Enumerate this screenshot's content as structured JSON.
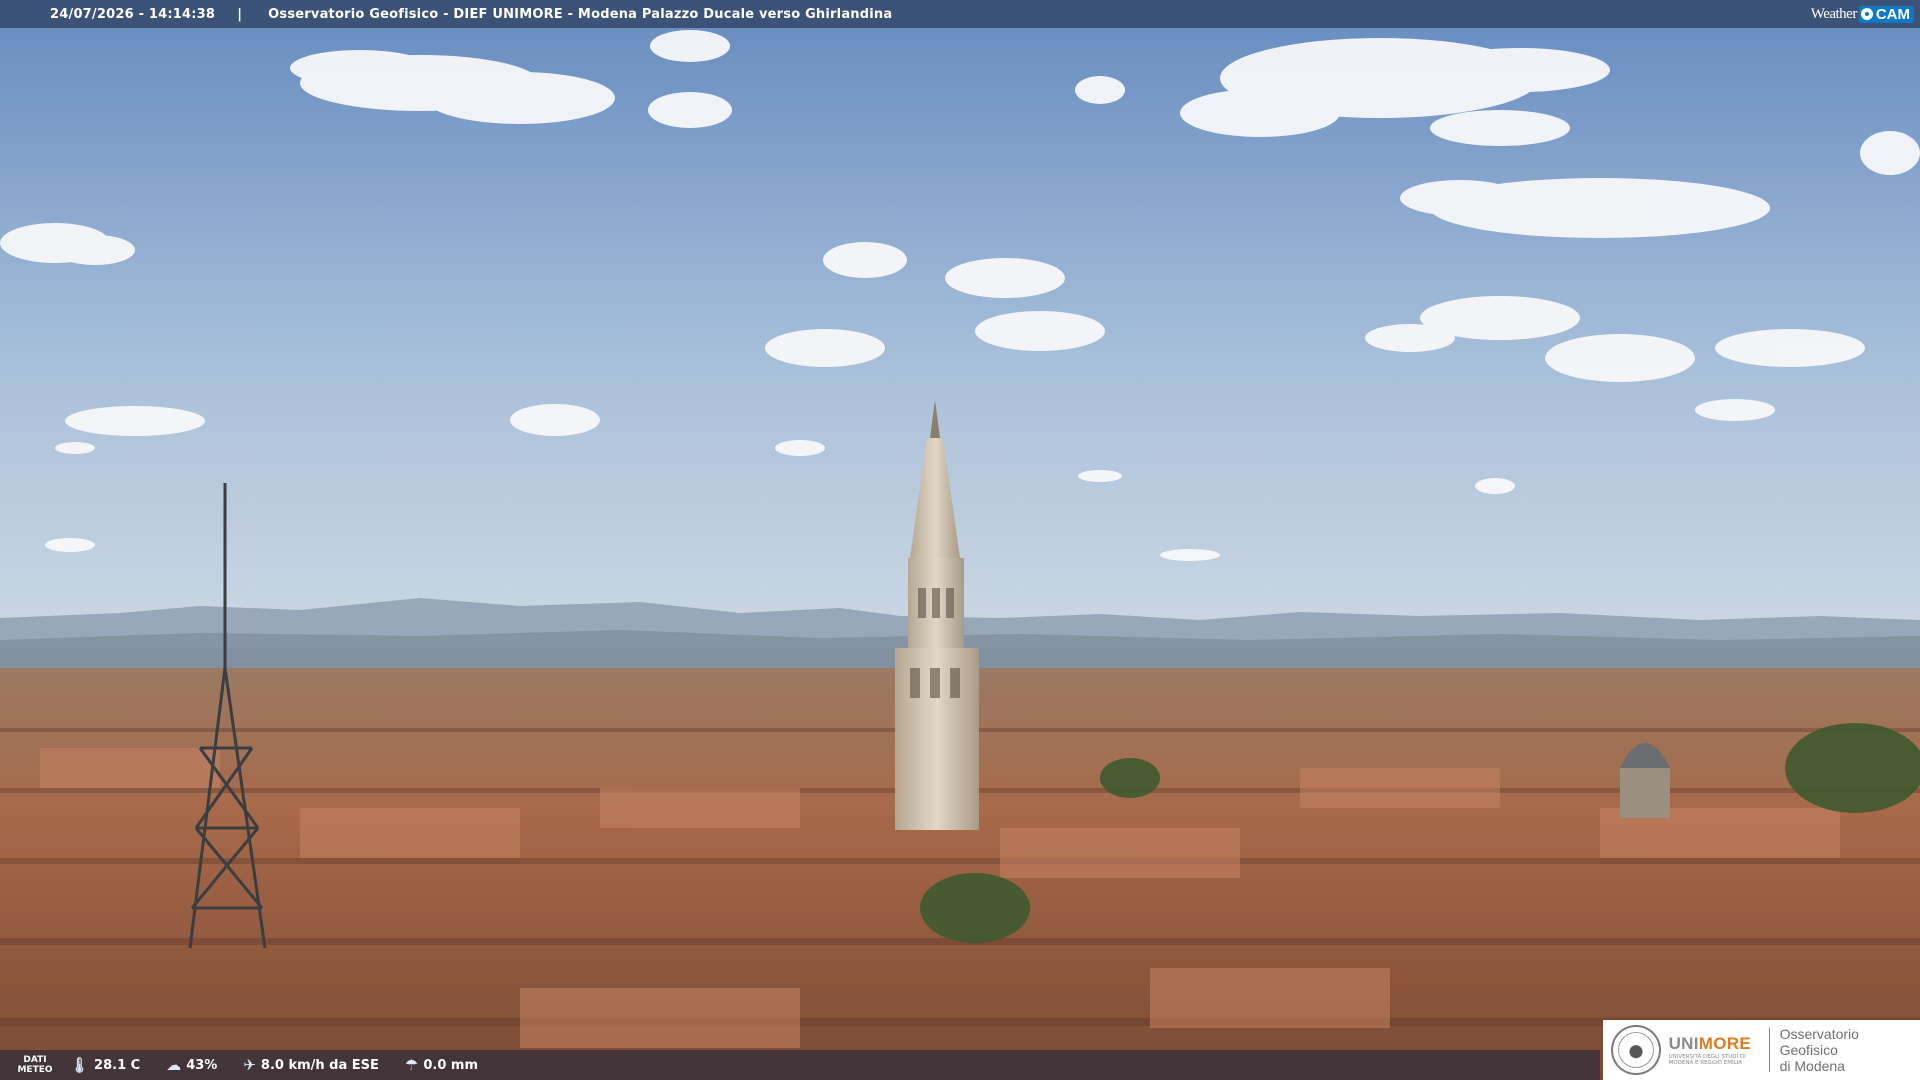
{
  "header": {
    "timestamp": "24/07/2026 - 14:14:38",
    "separator": "|",
    "caption": "Osservatorio Geofisico - DIEF UNIMORE - Modena Palazzo Ducale verso Ghirlandina"
  },
  "brand": {
    "weather": "Weather",
    "cam": "CAM"
  },
  "meteo": {
    "label_line1": "DATI",
    "label_line2": "METEO",
    "temperature": "28.1 C",
    "humidity": "43%",
    "wind": "8.0 km/h da ESE",
    "rain": "0.0 mm",
    "icons": [
      "thermometer-icon",
      "humidity-icon",
      "wind-icon",
      "rain-icon"
    ]
  },
  "logo": {
    "uni_a": "UNI",
    "uni_b": "MORE",
    "uni_sub": "UNIVERSITÀ DEGLI STUDI DI MODENA E REGGIO EMILIA",
    "obs_line1": "Osservatorio Geofisico",
    "obs_line2": "di Modena"
  },
  "colors": {
    "sky_top": "#6f93c4",
    "sky_bottom": "#c8d6e4",
    "roof": "#b07050",
    "tower": "#c9bfae",
    "accent": "#e07b1f"
  }
}
